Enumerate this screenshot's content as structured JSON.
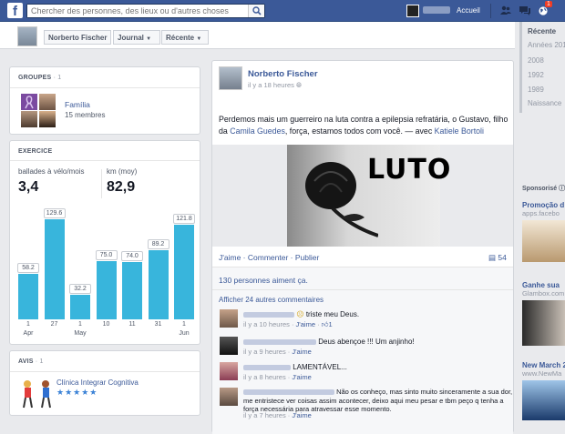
{
  "topbar": {
    "search_placeholder": "Chercher des personnes, des lieux ou d'autres choses",
    "home": "Accueil",
    "notifications": "1",
    "logo": "f"
  },
  "subbar": {
    "name": "Norberto Fischer",
    "journal": "Journal",
    "recent": "Récente"
  },
  "groups": {
    "title": "GROUPES",
    "count": "· 1",
    "name": "Família",
    "members": "15 membres"
  },
  "exercise": {
    "title": "EXERCICE",
    "stat1_label": "ballades à vélo/mois",
    "stat1_value": "3,4",
    "stat2_label": "km (moy)",
    "stat2_value": "82,9"
  },
  "chart_data": {
    "type": "bar",
    "values": [
      58.2,
      129.6,
      32.2,
      75.0,
      74.0,
      89.2,
      121.8
    ],
    "labels": [
      "58.2",
      "129.6",
      "32.2",
      "75.0",
      "74.0",
      "89.2",
      "121.8"
    ],
    "ticks": [
      "1",
      "27",
      "1",
      "10",
      "11",
      "31",
      "1"
    ],
    "months": [
      "Apr",
      "",
      "May",
      "",
      "",
      "",
      "Jun"
    ],
    "ylim": [
      0,
      135
    ],
    "color": "#38b5dc"
  },
  "reviews": {
    "title": "AVIS",
    "count": "· 1",
    "name": "Clínica Integrar Cognitiva",
    "stars": "★★★★★"
  },
  "post": {
    "author": "Norberto Fischer",
    "time": "il y a 18 heures",
    "text": "Perdemos mais um guerreiro na luta contra a epilepsia refratária, o Gustavo, filho da ",
    "tag1": "Camila Guedes",
    "text2": ", força, estamos todos com você. — avec ",
    "tag2": "Katiele Bortoli",
    "image_text": "LUTO",
    "actions": {
      "like": "J'aime",
      "comment": "Commenter",
      "share": "Publier",
      "sep": "·",
      "comments_count": "54"
    },
    "likes": "130 personnes aiment ça.",
    "more_comments": "Afficher 24 autres commentaires",
    "comments": [
      {
        "text": "triste meu Deus.",
        "time": "il y a 10 heures",
        "like": "J'aime",
        "likes": "1"
      },
      {
        "text": "Deus abençoe !!! Um anjinho!",
        "time": "il y a 9 heures",
        "like": "J'aime"
      },
      {
        "text": "LAMENTÁVEL...",
        "time": "il y a 8 heures",
        "like": "J'aime"
      },
      {
        "text": "Não os conheço, mas sinto muito sinceramente a sua dor, me entristece ver coisas assim acontecer, deixo aqui meu pesar e tbm peço q tenha a força necessária para atravessar esse momento.",
        "time": "il y a 7 heures",
        "like": "J'aime"
      }
    ]
  },
  "timeline": {
    "items": [
      "Récente",
      "Années 201",
      "2008",
      "1992",
      "1989",
      "Naissance"
    ]
  },
  "ads": {
    "sponsored": "Sponsorisé ⓘ",
    "ad1_title": "Promoção d",
    "ad1_site": "apps.facebo",
    "ad2_title": "Ganhe sua",
    "ad2_site": "Glambox.com",
    "ad3_title": "New March 2",
    "ad3_site": "www.NewMa"
  }
}
